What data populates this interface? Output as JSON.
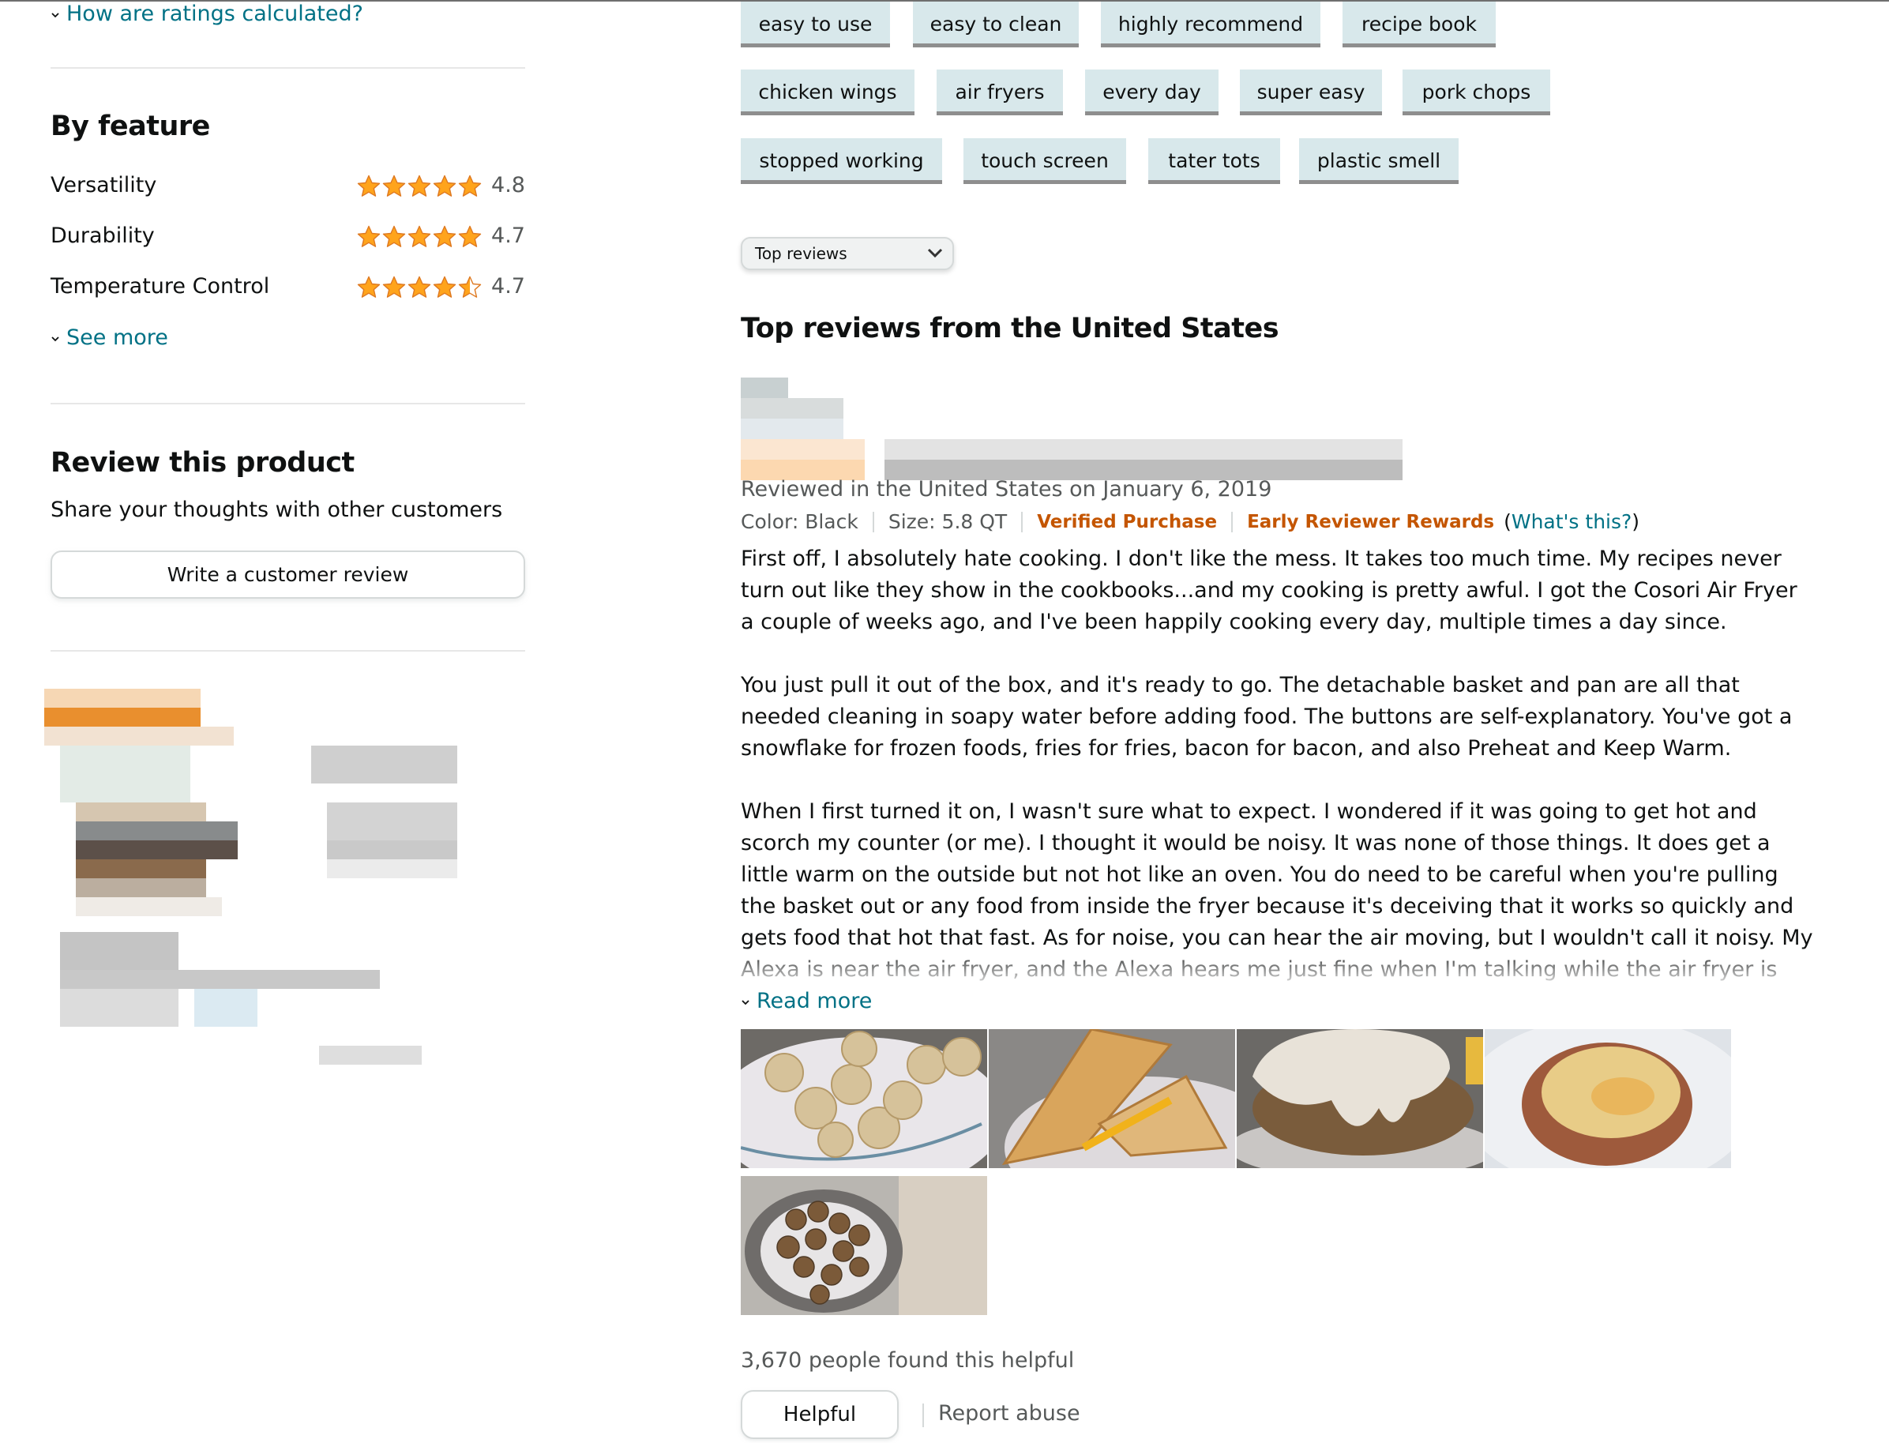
{
  "ratings": {
    "how_calculated_link": "How are ratings calculated?"
  },
  "by_feature": {
    "title": "By feature",
    "features": [
      {
        "name": "Versatility",
        "rating": 4.8,
        "value_label": "4.8",
        "stars_filled": 5
      },
      {
        "name": "Durability",
        "rating": 4.7,
        "value_label": "4.7",
        "stars_filled": 5
      },
      {
        "name": "Temperature Control",
        "rating": 4.7,
        "value_label": "4.7",
        "stars_filled": 4.5
      }
    ],
    "see_more": "See more"
  },
  "review_product": {
    "title": "Review this product",
    "subtitle": "Share your thoughts with other customers",
    "button_label": "Write a customer review"
  },
  "keyword_chips": [
    [
      "easy to use",
      "easy to clean",
      "highly recommend",
      "recipe book"
    ],
    [
      "chicken wings",
      "air fryers",
      "every day",
      "super easy",
      "pork chops"
    ],
    [
      "stopped working",
      "touch screen",
      "tater tots",
      "plastic smell"
    ]
  ],
  "sort": {
    "selected": "Top reviews"
  },
  "reviews_section": {
    "title": "Top reviews from the United States"
  },
  "review": {
    "date_line": "Reviewed in the United States on January 6, 2019",
    "color": "Color: Black",
    "size": "Size: 5.8 QT",
    "verified": "Verified Purchase",
    "early_reviewer": "Early Reviewer Rewards",
    "whats_this": "What's this?",
    "paragraphs": [
      "First off, I absolutely hate cooking. I don't like the mess. It takes too much time. My recipes never turn out like they show in the cookbooks...and my cooking is pretty awful. I got the Cosori Air Fryer a couple of weeks ago, and I've been happily cooking every day, multiple times a day since.",
      "You just pull it out of the box, and it's ready to go. The detachable basket and pan are all that needed cleaning in soapy water before adding food. The buttons are self-explanatory. You've got a snowflake for frozen foods, fries for fries, bacon for bacon, and also Preheat and Keep Warm.",
      "When I first turned it on, I wasn't sure what to expect. I wondered if it was going to get hot and scorch my counter (or me). I thought it would be noisy. It was none of those things. It does get a little warm on the outside but not hot like an oven. You do need to be careful when you're pulling the basket out or any food from inside the fryer because it's deceiving that it works so quickly and gets food that hot that fast. As for noise, you can hear the air moving, but I wouldn't call it noisy. My Alexa is near the air fryer, and the Alexa hears me just fine when I'm talking while the air fryer is running. Also, since my Alexa is near the air fryer,"
    ],
    "read_more": "Read more",
    "photos": [
      {
        "icon": "food-photo-breaded-bites-icon"
      },
      {
        "icon": "food-photo-grilled-cheese-icon"
      },
      {
        "icon": "food-photo-chicken-fried-steak-icon"
      },
      {
        "icon": "food-photo-pizza-icon"
      },
      {
        "icon": "food-photo-fried-bites-icon"
      }
    ],
    "helpful_count": "3,670 people found this helpful",
    "helpful_button": "Helpful",
    "report_abuse": "Report abuse"
  },
  "colors": {
    "link": "#007185",
    "star": "#ffa41c",
    "star_stroke": "#de7921",
    "badge_orange": "#c45500",
    "chip_bg": "#d8e8eb"
  }
}
